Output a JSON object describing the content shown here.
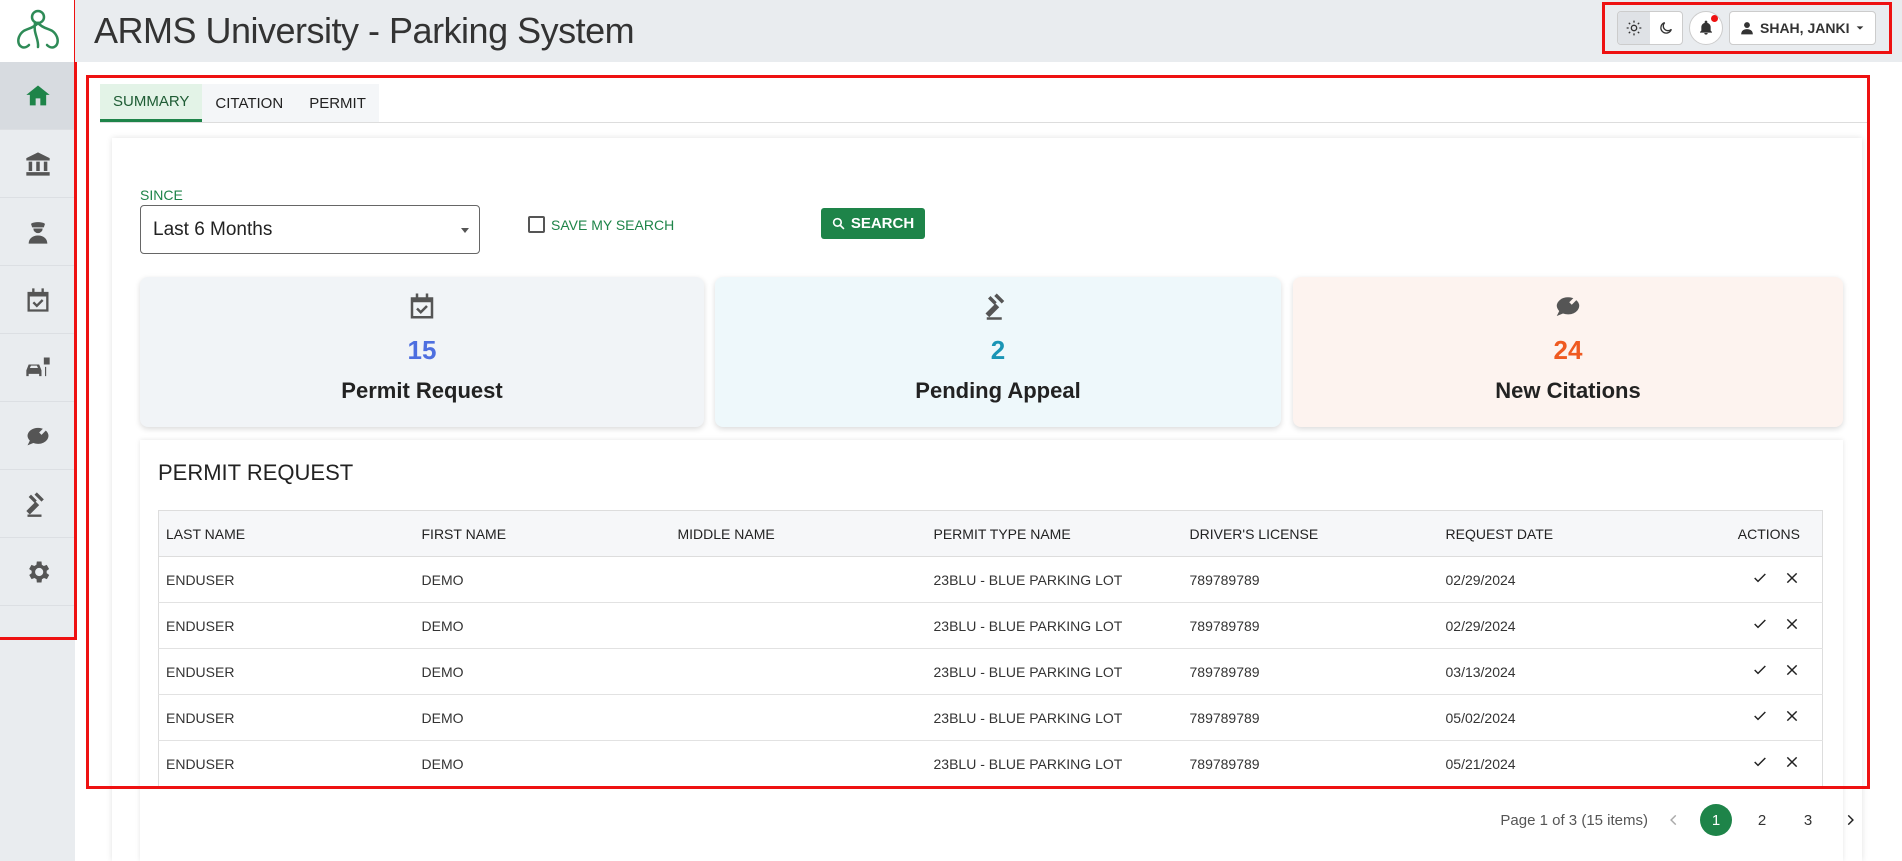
{
  "app": {
    "title": "ARMS University - Parking System"
  },
  "header": {
    "user_name": "SHAH, JANKI"
  },
  "tabs": [
    {
      "label": "SUMMARY",
      "active": true
    },
    {
      "label": "CITATION",
      "active": false
    },
    {
      "label": "PERMIT",
      "active": false
    }
  ],
  "filter": {
    "since_label": "SINCE",
    "since_value": "Last 6 Months",
    "save_search_label": "SAVE MY SEARCH",
    "search_button": "SEARCH"
  },
  "cards": [
    {
      "value": "15",
      "label": "Permit Request",
      "color": "#4e6fe0"
    },
    {
      "value": "2",
      "label": "Pending Appeal",
      "color": "#1a95b5"
    },
    {
      "value": "24",
      "label": "New Citations",
      "color": "#ef5a21"
    }
  ],
  "table": {
    "title": "PERMIT REQUEST",
    "columns": [
      "LAST NAME",
      "FIRST NAME",
      "MIDDLE NAME",
      "PERMIT TYPE NAME",
      "DRIVER'S LICENSE",
      "REQUEST DATE",
      "ACTIONS"
    ],
    "rows": [
      [
        "ENDUSER",
        "DEMO",
        "",
        "23BLU - BLUE PARKING LOT",
        "789789789",
        "02/29/2024"
      ],
      [
        "ENDUSER",
        "DEMO",
        "",
        "23BLU - BLUE PARKING LOT",
        "789789789",
        "02/29/2024"
      ],
      [
        "ENDUSER",
        "DEMO",
        "",
        "23BLU - BLUE PARKING LOT",
        "789789789",
        "03/13/2024"
      ],
      [
        "ENDUSER",
        "DEMO",
        "",
        "23BLU - BLUE PARKING LOT",
        "789789789",
        "05/02/2024"
      ],
      [
        "ENDUSER",
        "DEMO",
        "",
        "23BLU - BLUE PARKING LOT",
        "789789789",
        "05/21/2024"
      ]
    ]
  },
  "pager": {
    "summary": "Page 1 of 3 (15 items)",
    "pages": [
      "1",
      "2",
      "3"
    ]
  },
  "colors": {
    "accent": "#1e8449",
    "highlight": "#ee1111"
  }
}
